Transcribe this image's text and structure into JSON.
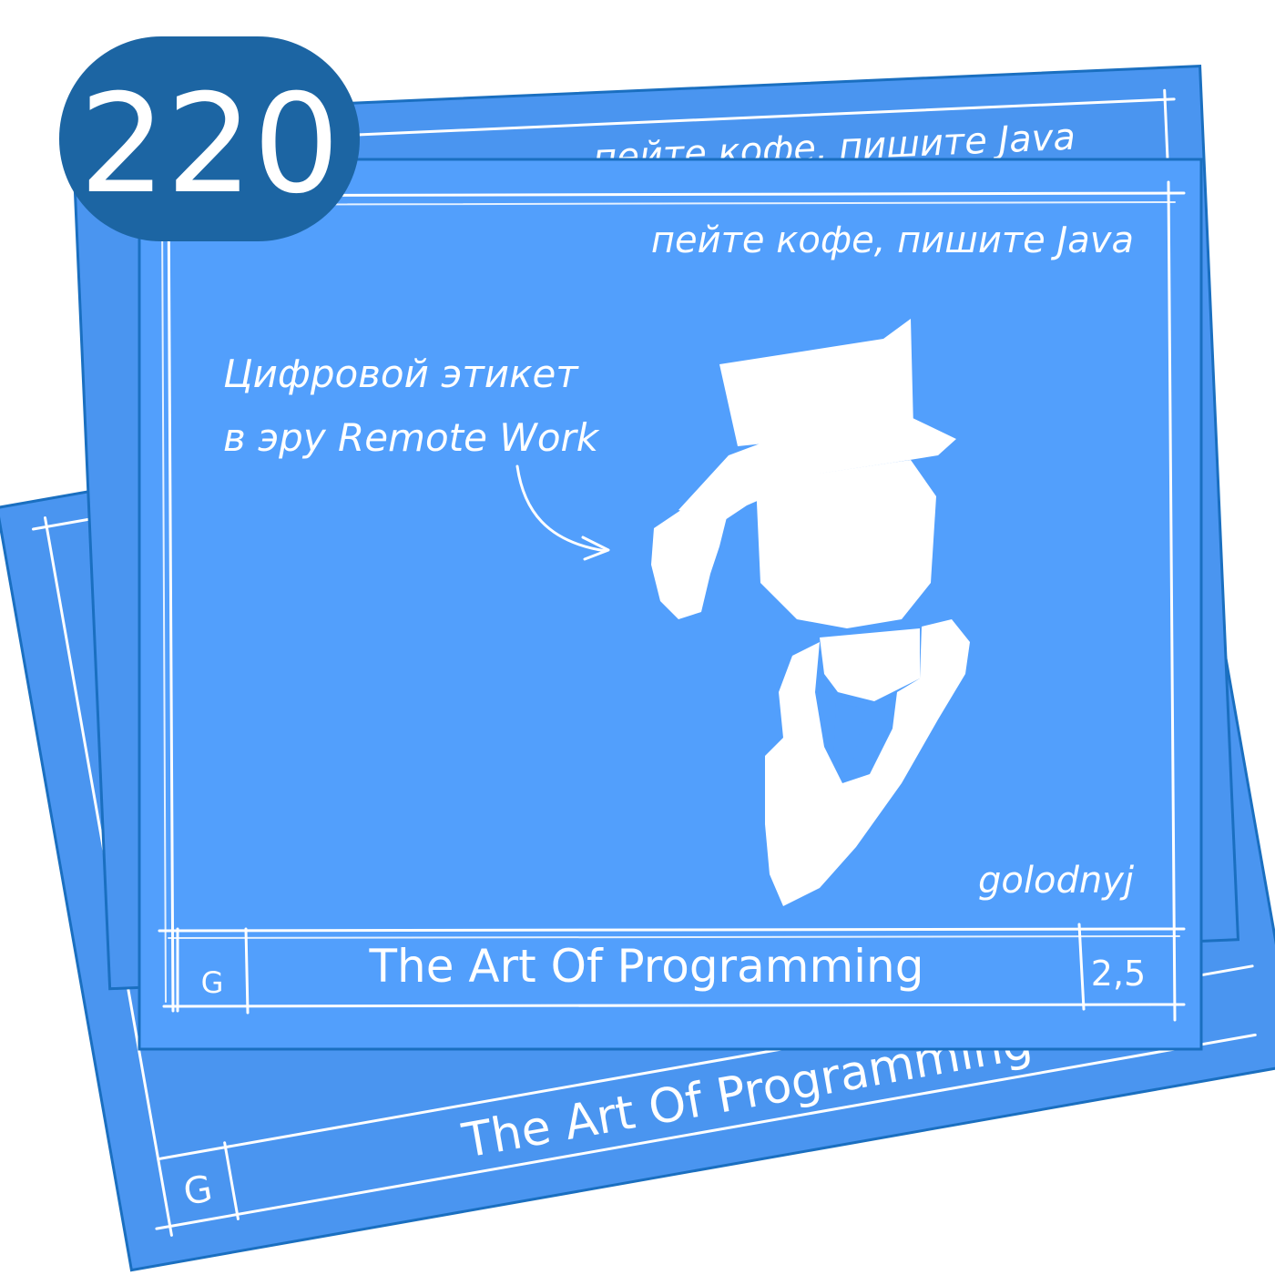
{
  "episode_number": "220",
  "colors": {
    "card": "#529ffc",
    "card_back": "#4a95f0",
    "card_border": "#1a6fc0",
    "badge": "#1c65a3",
    "chalk": "#ffffff"
  },
  "back_card_top": {
    "tagline": "пейте кофе, пишите Java"
  },
  "back_card_bottom": {
    "title": "The Art Of Programming",
    "corner_letter": "G"
  },
  "front_card": {
    "tagline": "пейте кофе, пишите Java",
    "speech_line_1": "Цифровой этикет",
    "speech_line_2": "в эру Remote Work",
    "signature": "golodnyj",
    "footer": {
      "corner_letter": "G",
      "title": "The Art Of Programming",
      "corner_number": "2,5"
    },
    "illustration": "gentleman-top-hat-silhouette"
  }
}
